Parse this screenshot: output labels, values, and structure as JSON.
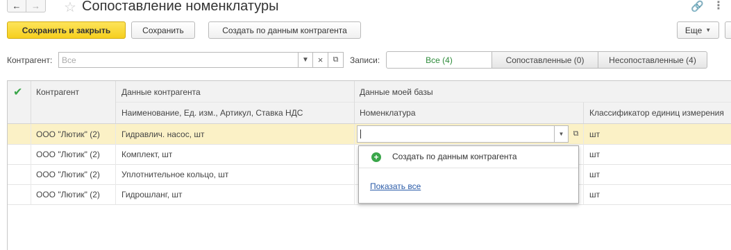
{
  "title": "Сопоставление номенклатуры",
  "toolbar": {
    "save_close": "Сохранить и закрыть",
    "save": "Сохранить",
    "create_from_counterparty": "Создать по данным контрагента",
    "more": "Еще"
  },
  "filter": {
    "counterparty_label": "Контрагент:",
    "counterparty_placeholder": "Все",
    "clear_symbol": "×",
    "records_label": "Записи:",
    "segments": [
      "Все (4)",
      "Сопоставленные (0)",
      "Несопоставленные (4)"
    ]
  },
  "table": {
    "col_counterparty": "Контрагент",
    "group_counterparty_data": "Данные контрагента",
    "group_my_base": "Данные моей базы",
    "col_name_details": "Наименование, Ед. изм., Артикул, Ставка НДС",
    "col_nomenclature": "Номенклатура",
    "col_unit_classifier": "Классификатор единиц измерения",
    "rows": [
      {
        "counterparty": "ООО \"Лютик\" (2)",
        "name": "Гидравлич. насос, шт",
        "unit": "шт"
      },
      {
        "counterparty": "ООО \"Лютик\" (2)",
        "name": "Комплект, шт",
        "unit": "шт"
      },
      {
        "counterparty": "ООО \"Лютик\" (2)",
        "name": "Уплотнительное кольцо, шт",
        "unit": "шт"
      },
      {
        "counterparty": "ООО \"Лютик\" (2)",
        "name": "Гидрошланг, шт",
        "unit": "шт"
      }
    ]
  },
  "dropdown": {
    "create_item": "Создать по данным контрагента",
    "show_all": "Показать все"
  },
  "colors": {
    "accent_yellow": "#f6cf1e",
    "selected_row": "#fbf1c6",
    "green": "#3aa64a",
    "link": "#2a5ba8"
  }
}
